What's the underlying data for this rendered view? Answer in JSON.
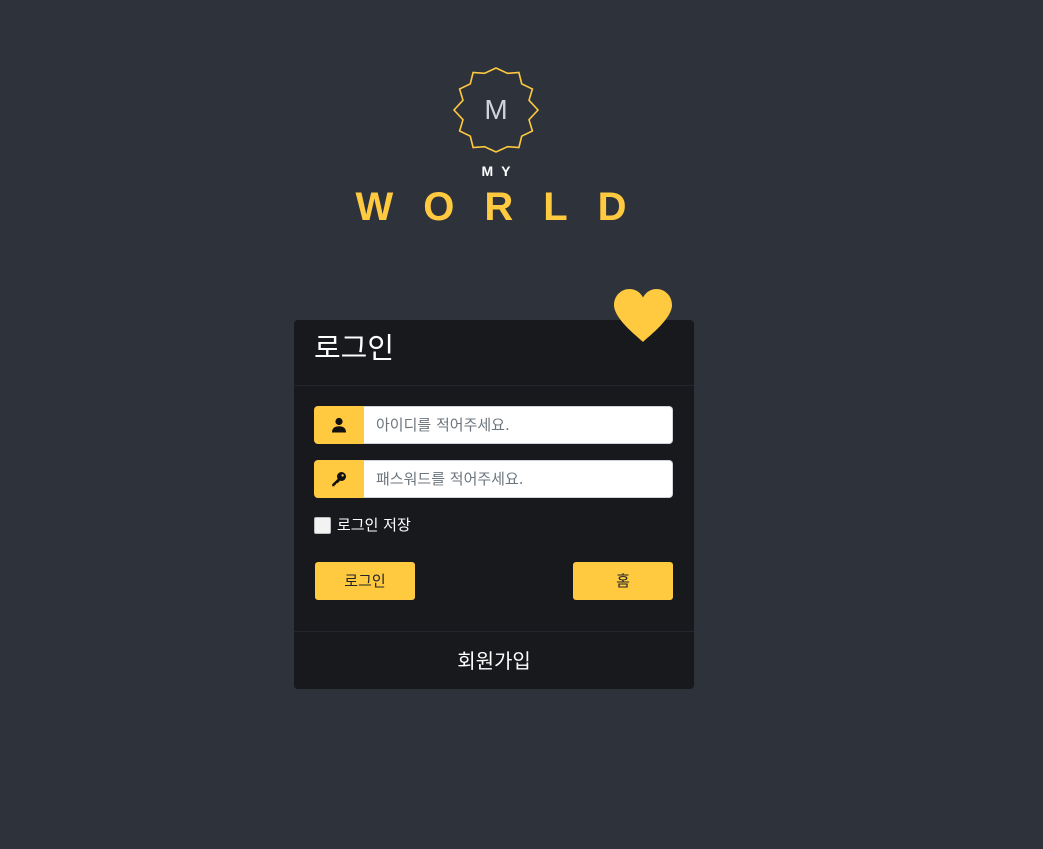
{
  "logo": {
    "badge_letter": "M",
    "line1": "MY",
    "line2": "WORLD",
    "colors": {
      "accent": "#ffc940",
      "badge_letter": "#cfd3dc"
    }
  },
  "login_card": {
    "title": "로그인",
    "username": {
      "value": "",
      "placeholder": "아이디를 적어주세요."
    },
    "password": {
      "value": "",
      "placeholder": "패스워드를 적어주세요."
    },
    "remember_label": "로그인 저장",
    "remember_checked": false,
    "login_button": "로그인",
    "home_button": "홈",
    "signup_link": "회원가입"
  },
  "icons": {
    "decor": "heart-icon",
    "username_addon": "user-icon",
    "password_addon": "key-icon"
  },
  "colors": {
    "background": "#2e333b",
    "card": "#17191d",
    "accent": "#ffc940"
  }
}
